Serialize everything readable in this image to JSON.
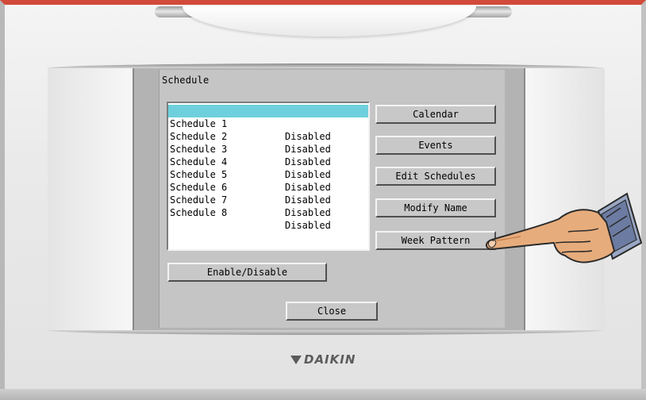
{
  "dialog": {
    "title": "Schedule"
  },
  "schedules": [
    {
      "name": "Schedule 1",
      "status": "Disabled",
      "selected": true
    },
    {
      "name": "Schedule 2",
      "status": "Disabled",
      "selected": false
    },
    {
      "name": "Schedule 3",
      "status": "Disabled",
      "selected": false
    },
    {
      "name": "Schedule 4",
      "status": "Disabled",
      "selected": false
    },
    {
      "name": "Schedule 5",
      "status": "Disabled",
      "selected": false
    },
    {
      "name": "Schedule 6",
      "status": "Disabled",
      "selected": false
    },
    {
      "name": "Schedule 7",
      "status": "Disabled",
      "selected": false
    },
    {
      "name": "Schedule 8",
      "status": "Disabled",
      "selected": false
    }
  ],
  "buttons": {
    "calendar": "Calendar",
    "events": "Events",
    "edit_schedules": "Edit Schedules",
    "modify_name": "Modify Name",
    "week_pattern": "Week Pattern",
    "enable_disable": "Enable/Disable",
    "close": "Close"
  },
  "brand": {
    "logo_text": "DAIKIN"
  },
  "colors": {
    "selection": "#6ed0dc",
    "dialog_bg": "#c5c5c5",
    "accent_top_edge": "#d24a3a"
  },
  "icons": {
    "pointer": "pointing-hand-icon",
    "logo_mark": "daikin-triangle-icon"
  }
}
